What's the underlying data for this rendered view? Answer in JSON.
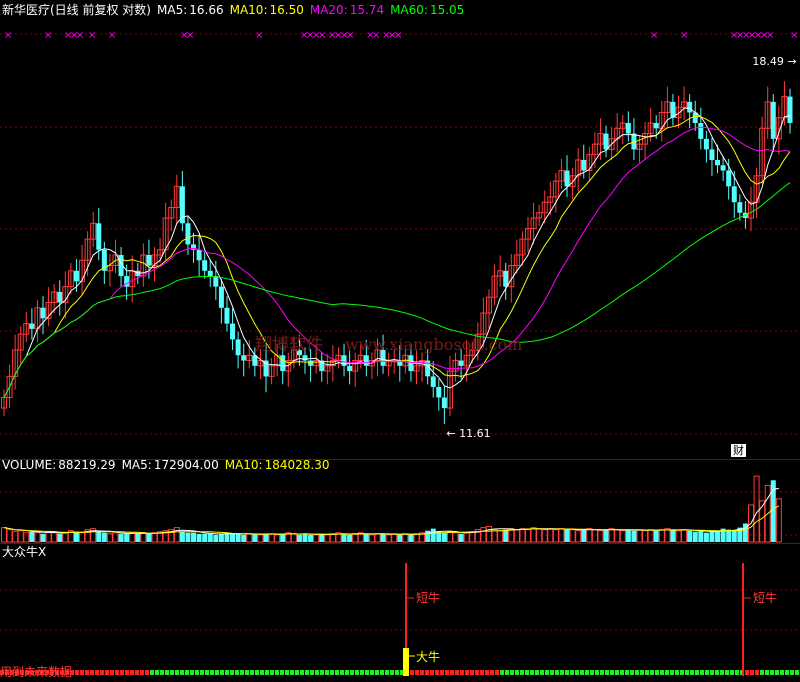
{
  "header": {
    "title": "新华医疗(日线 前复权 对数)",
    "ma5_label": "MA5:",
    "ma5_value": "16.66",
    "ma10_label": "MA10:",
    "ma10_value": "16.50",
    "ma20_label": "MA20:",
    "ma20_value": "15.74",
    "ma60_label": "MA60:",
    "ma60_value": "15.05"
  },
  "volume_header": {
    "label": "VOLUME:",
    "value": "88219.29",
    "ma5_label": "MA5:",
    "ma5_value": "172904.00",
    "ma10_label": "MA10:",
    "ma10_value": "184028.30"
  },
  "indicator_header": {
    "title": "大众牛X"
  },
  "badges": {
    "cai": "财"
  },
  "watermark": {
    "cn": "翔博软件",
    "url": "www.xiangbosoft.com"
  },
  "footer": {
    "text": "用到未来数据"
  },
  "signals": {
    "short_bull_1": "短牛",
    "big_bull": "大牛",
    "short_bull_2": "短牛"
  },
  "chart_data": {
    "type": "candlestick",
    "price_annotations": {
      "high": "18.49",
      "low": "11.61"
    },
    "price_range": [
      11.3,
      19.2
    ],
    "marker_glyph": "×",
    "colors": {
      "up": "#ff3b3b",
      "down": "#54ffff",
      "ma5": "#ffffff",
      "ma10": "#ffff00",
      "ma20": "#ff00ff",
      "ma60": "#00ff00",
      "marker": "#ff00ff",
      "grid": "#8b0000"
    },
    "prices": [
      12.2,
      12.6,
      13.1,
      13.4,
      13.6,
      13.5,
      13.9,
      13.7,
      14.0,
      14.2,
      14.0,
      14.3,
      14.6,
      14.4,
      14.8,
      15.2,
      15.5,
      15.0,
      14.6,
      14.7,
      14.9,
      14.5,
      14.3,
      14.6,
      14.5,
      14.9,
      14.7,
      14.9,
      15.0,
      15.6,
      15.8,
      16.2,
      15.5,
      15.1,
      15.0,
      14.8,
      14.6,
      14.5,
      14.3,
      13.9,
      13.6,
      13.3,
      13.0,
      12.9,
      13.0,
      12.8,
      12.9,
      12.6,
      12.8,
      13.0,
      12.7,
      12.9,
      13.1,
      13.0,
      12.9,
      12.8,
      12.9,
      12.7,
      12.8,
      12.9,
      13.0,
      12.8,
      12.7,
      12.9,
      13.0,
      12.8,
      12.9,
      13.1,
      12.8,
      12.9,
      12.9,
      12.8,
      13.0,
      12.7,
      12.8,
      12.9,
      12.6,
      12.4,
      12.2,
      12.0,
      12.7,
      12.9,
      12.8,
      13.0,
      13.1,
      13.4,
      13.8,
      14.1,
      14.5,
      14.6,
      14.3,
      14.7,
      14.9,
      15.2,
      15.4,
      15.6,
      15.7,
      15.9,
      16.0,
      16.3,
      16.5,
      16.2,
      16.4,
      16.7,
      16.5,
      16.8,
      17.0,
      17.2,
      16.9,
      17.1,
      17.3,
      17.4,
      17.2,
      16.9,
      17.0,
      17.2,
      17.4,
      17.3,
      17.6,
      17.8,
      17.5,
      17.7,
      17.8,
      17.6,
      17.4,
      17.1,
      16.9,
      16.7,
      16.6,
      16.5,
      16.2,
      15.9,
      15.7,
      15.6,
      15.9,
      16.4,
      17.3,
      17.8,
      17.1,
      17.5,
      17.9,
      17.4
    ],
    "volumes": [
      14,
      12,
      10,
      11,
      9,
      10,
      9,
      8,
      10,
      9,
      8,
      9,
      11,
      10,
      9,
      12,
      13,
      10,
      9,
      8,
      9,
      8,
      8,
      9,
      8,
      9,
      8,
      9,
      10,
      11,
      12,
      14,
      10,
      9,
      9,
      8,
      8,
      8,
      7,
      8,
      9,
      8,
      8,
      7,
      8,
      8,
      7,
      8,
      8,
      7,
      8,
      9,
      8,
      7,
      8,
      7,
      7,
      8,
      7,
      8,
      9,
      8,
      7,
      8,
      9,
      8,
      7,
      8,
      8,
      7,
      8,
      7,
      8,
      7,
      8,
      9,
      11,
      13,
      10,
      9,
      10,
      9,
      8,
      9,
      10,
      12,
      14,
      15,
      12,
      11,
      12,
      13,
      12,
      13,
      12,
      14,
      13,
      12,
      13,
      12,
      13,
      12,
      12,
      11,
      12,
      13,
      12,
      11,
      12,
      13,
      12,
      11,
      12,
      11,
      12,
      11,
      12,
      11,
      12,
      13,
      12,
      11,
      12,
      11,
      10,
      11,
      9,
      10,
      11,
      13,
      12,
      11,
      14,
      18,
      36,
      64,
      40,
      55,
      60,
      42
    ],
    "signal_markers": [
      "短牛",
      "大牛",
      "短牛"
    ]
  }
}
